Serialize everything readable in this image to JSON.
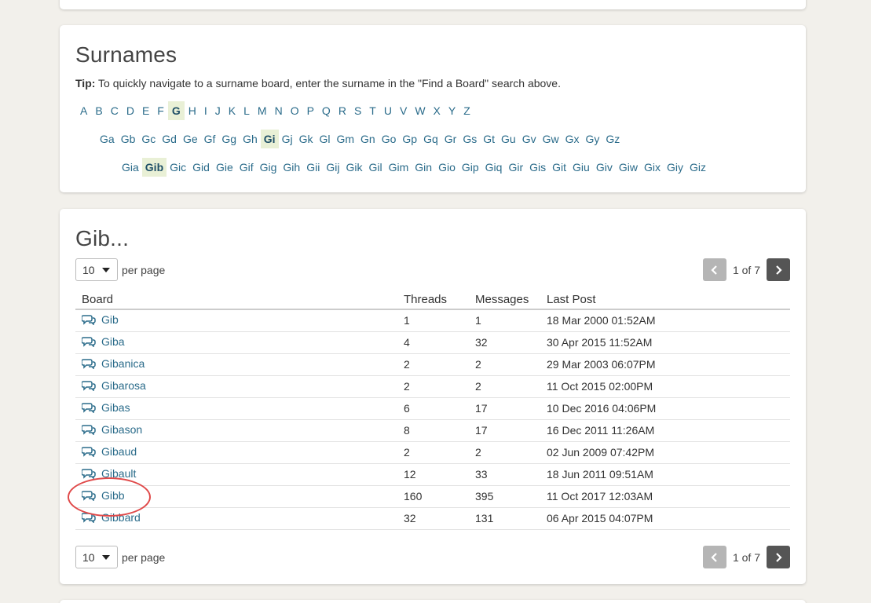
{
  "surnames": {
    "title": "Surnames",
    "tip_label": "Tip:",
    "tip_text": " To quickly navigate to a surname board, enter the surname in the \"Find a Board\" search above.",
    "letters": [
      "A",
      "B",
      "C",
      "D",
      "E",
      "F",
      "G",
      "H",
      "I",
      "J",
      "K",
      "L",
      "M",
      "N",
      "O",
      "P",
      "Q",
      "R",
      "S",
      "T",
      "U",
      "V",
      "W",
      "X",
      "Y",
      "Z"
    ],
    "active_letter": "G",
    "second_level": [
      "Ga",
      "Gb",
      "Gc",
      "Gd",
      "Ge",
      "Gf",
      "Gg",
      "Gh",
      "Gi",
      "Gj",
      "Gk",
      "Gl",
      "Gm",
      "Gn",
      "Go",
      "Gp",
      "Gq",
      "Gr",
      "Gs",
      "Gt",
      "Gu",
      "Gv",
      "Gw",
      "Gx",
      "Gy",
      "Gz"
    ],
    "active_second": "Gi",
    "third_level": [
      "Gia",
      "Gib",
      "Gic",
      "Gid",
      "Gie",
      "Gif",
      "Gig",
      "Gih",
      "Gii",
      "Gij",
      "Gik",
      "Gil",
      "Gim",
      "Gin",
      "Gio",
      "Gip",
      "Giq",
      "Gir",
      "Gis",
      "Git",
      "Giu",
      "Giv",
      "Giw",
      "Gix",
      "Giy",
      "Giz"
    ],
    "active_third": "Gib"
  },
  "results": {
    "title": "Gib...",
    "per_page_value": "10",
    "per_page_label": "per page",
    "page_info": "1 of 7",
    "columns": [
      "Board",
      "Threads",
      "Messages",
      "Last Post"
    ],
    "rows": [
      {
        "board": "Gib",
        "threads": "1",
        "messages": "1",
        "last_post": "18 Mar 2000 01:52AM"
      },
      {
        "board": "Giba",
        "threads": "4",
        "messages": "32",
        "last_post": "30 Apr 2015 11:52AM"
      },
      {
        "board": "Gibanica",
        "threads": "2",
        "messages": "2",
        "last_post": "29 Mar 2003 06:07PM"
      },
      {
        "board": "Gibarosa",
        "threads": "2",
        "messages": "2",
        "last_post": "11 Oct 2015 02:00PM"
      },
      {
        "board": "Gibas",
        "threads": "6",
        "messages": "17",
        "last_post": "10 Dec 2016 04:06PM"
      },
      {
        "board": "Gibason",
        "threads": "8",
        "messages": "17",
        "last_post": "16 Dec 2011 11:26AM"
      },
      {
        "board": "Gibaud",
        "threads": "2",
        "messages": "2",
        "last_post": "02 Jun 2009 07:42PM"
      },
      {
        "board": "Gibault",
        "threads": "12",
        "messages": "33",
        "last_post": "18 Jun 2011 09:51AM"
      },
      {
        "board": "Gibb",
        "threads": "160",
        "messages": "395",
        "last_post": "11 Oct 2017 12:03AM"
      },
      {
        "board": "Gibbard",
        "threads": "32",
        "messages": "131",
        "last_post": "06 Apr 2015 04:07PM"
      }
    ]
  },
  "icons": {
    "board": "chat-bubbles-icon",
    "prev": "chevron-left-icon",
    "next": "chevron-right-icon",
    "select_caret": "caret-down-icon"
  },
  "colors": {
    "link": "#2a6b8a",
    "active_bg": "#e9f0d6",
    "annotation": "#e04a4a",
    "page_bg": "#f2f0eb"
  }
}
